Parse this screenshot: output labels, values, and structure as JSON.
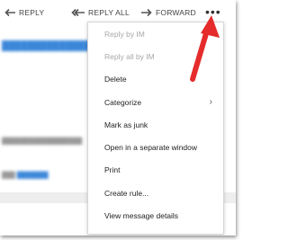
{
  "toolbar": {
    "reply_label": "REPLY",
    "reply_all_label": "REPLY ALL",
    "forward_label": "FORWARD",
    "more_label": "•••"
  },
  "menu": {
    "items": [
      {
        "label": "Reply by IM",
        "enabled": false
      },
      {
        "label": "Reply all by IM",
        "enabled": false
      },
      {
        "label": "Delete",
        "enabled": true
      },
      {
        "label": "Categorize",
        "enabled": true,
        "submenu": true
      },
      {
        "label": "Mark as junk",
        "enabled": true
      },
      {
        "label": "Open in a separate window",
        "enabled": true
      },
      {
        "label": "Print",
        "enabled": true
      },
      {
        "label": "Create rule...",
        "enabled": true
      },
      {
        "label": "View message details",
        "enabled": true
      }
    ],
    "submenu_glyph": "›"
  },
  "colors": {
    "annotation_arrow": "#e52b2b",
    "link": "#3a86d8",
    "disabled_text": "#a8a8a8"
  }
}
